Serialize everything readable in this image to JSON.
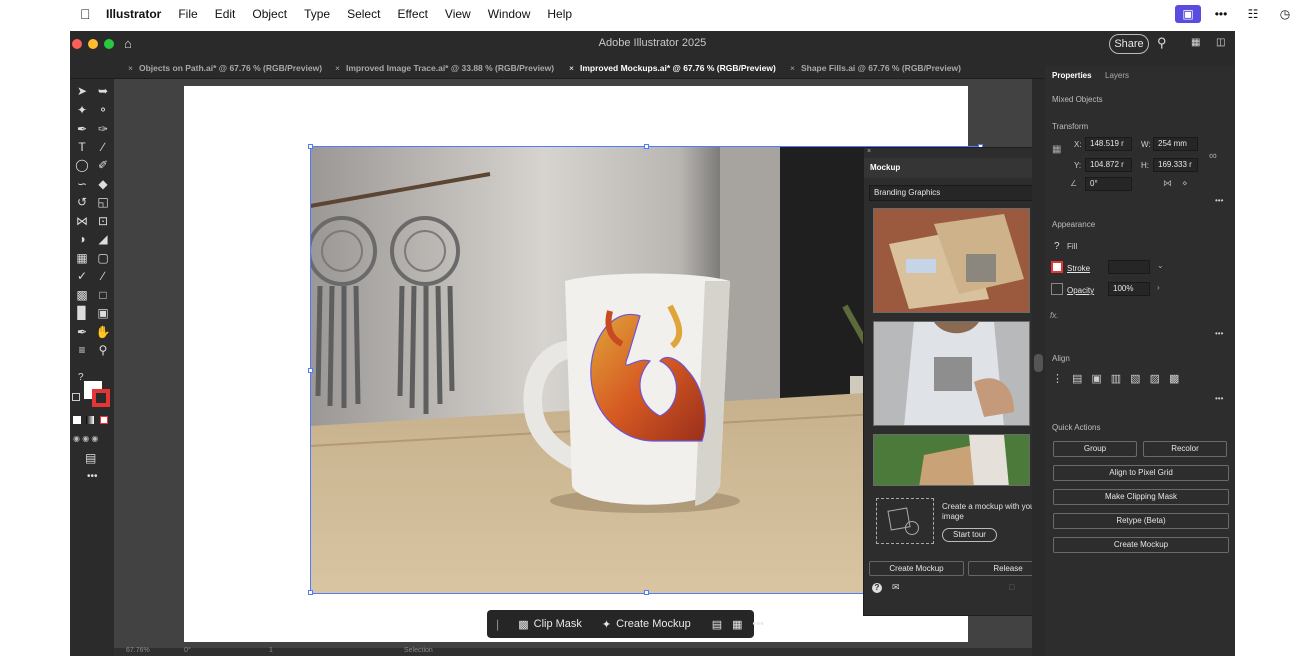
{
  "menubar": {
    "app_name": "Illustrator",
    "menus": [
      "File",
      "Edit",
      "Object",
      "Type",
      "Select",
      "Effect",
      "View",
      "Window",
      "Help"
    ]
  },
  "window": {
    "title": "Adobe Illustrator 2025",
    "share_label": "Share"
  },
  "tabs": [
    {
      "label": "Objects on Path.ai* @ 67.76 % (RGB/Preview)"
    },
    {
      "label": "Improved Image Trace.ai* @ 33.88 % (RGB/Preview)"
    },
    {
      "label": "Improved Mockups.ai* @ 67.76 % (RGB/Preview)"
    },
    {
      "label": "Shape Fills.ai @ 67.76 % (RGB/Preview)"
    }
  ],
  "context_bar": {
    "clip_mask": "Clip Mask",
    "create_mockup": "Create Mockup"
  },
  "mockup_panel": {
    "title": "Mockup",
    "category": "Branding Graphics",
    "promo_text": "Create a mockup with your image",
    "start_tour": "Start tour",
    "create_mockup": "Create Mockup",
    "release": "Release"
  },
  "properties": {
    "tabs": [
      "Properties",
      "Layers"
    ],
    "selection": "Mixed Objects",
    "transform": {
      "title": "Transform",
      "x_label": "X:",
      "x": "148.519 r",
      "y_label": "Y:",
      "y": "104.872 r",
      "w_label": "W:",
      "w": "254 mm",
      "h_label": "H:",
      "h": "169.333 r",
      "angle": "0°"
    },
    "appearance": {
      "title": "Appearance",
      "fill": "Fill",
      "stroke": "Stroke",
      "opacity_label": "Opacity",
      "opacity": "100%"
    },
    "fx": "fx.",
    "align_title": "Align",
    "quick_actions": {
      "title": "Quick Actions",
      "group": "Group",
      "recolor": "Recolor",
      "align_pixel": "Align to Pixel Grid",
      "clipping": "Make Clipping Mask",
      "retype": "Retype (Beta)",
      "create_mockup": "Create Mockup"
    }
  },
  "status": {
    "zoom": "67.76%",
    "angle": "0°",
    "artboard": "1",
    "tool": "Selection"
  },
  "colors": {
    "accent": "#4f7bff",
    "panel": "#2d2d2d",
    "canvas": "#424242"
  }
}
